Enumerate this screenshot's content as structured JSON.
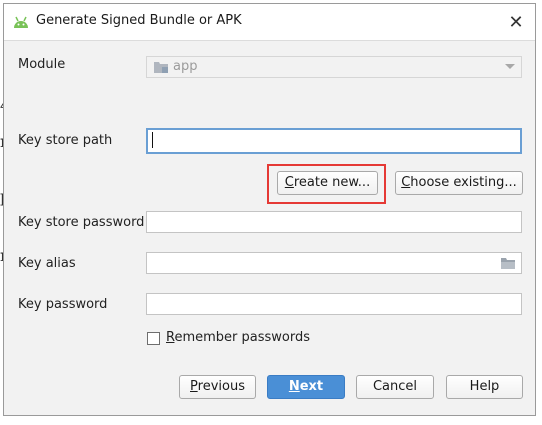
{
  "dialog": {
    "title": "Generate Signed Bundle or APK",
    "close_glyph": "✕"
  },
  "module": {
    "label": "Module",
    "value": "app",
    "icon": "module-folder-icon"
  },
  "key_store_path": {
    "label": "Key store path",
    "value": ""
  },
  "buttons": {
    "create_new_underlined": "C",
    "create_new_rest": "reate new...",
    "choose_existing_underlined": "C",
    "choose_existing_rest": "hoose existing...",
    "previous_underlined": "P",
    "previous_rest": "revious",
    "next_underlined": "N",
    "next_rest": "ext",
    "cancel": "Cancel",
    "help": "Help"
  },
  "key_store_password": {
    "label": "Key store password",
    "value": ""
  },
  "key_alias": {
    "label": "Key alias",
    "value": "",
    "icon": "folder-icon"
  },
  "key_password": {
    "label": "Key password",
    "value": ""
  },
  "remember": {
    "label_underlined": "R",
    "label_rest": "emember passwords",
    "checked": false
  },
  "colors": {
    "highlight": "#e53935",
    "primary_button": "#4a8fd6",
    "focus_border": "#6a9fd4"
  }
}
